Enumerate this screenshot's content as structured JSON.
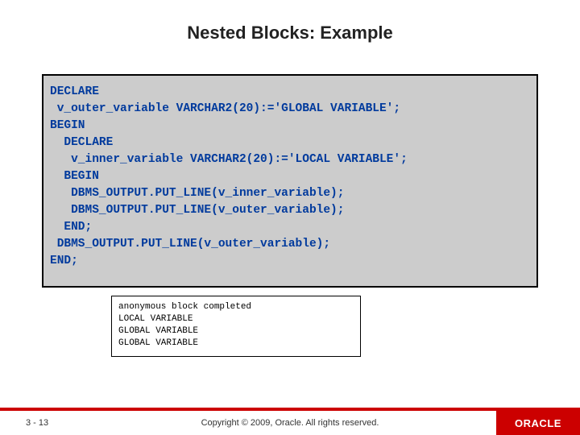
{
  "title": "Nested Blocks: Example",
  "code": {
    "l1": "DECLARE",
    "l2": " v_outer_variable VARCHAR2(20):='GLOBAL VARIABLE';",
    "l3": "BEGIN",
    "l4": "  DECLARE",
    "l5": "   v_inner_variable VARCHAR2(20):='LOCAL VARIABLE';",
    "l6": "  BEGIN",
    "l7": "   DBMS_OUTPUT.PUT_LINE(v_inner_variable);",
    "l8": "   DBMS_OUTPUT.PUT_LINE(v_outer_variable);",
    "l9": "  END;",
    "l10": " DBMS_OUTPUT.PUT_LINE(v_outer_variable);",
    "l11": "END;"
  },
  "output": {
    "l1": "anonymous block completed",
    "l2": "LOCAL VARIABLE",
    "l3": "GLOBAL VARIABLE",
    "l4": "GLOBAL VARIABLE"
  },
  "footer": {
    "page": "3 - 13",
    "copyright": "Copyright © 2009, Oracle. All rights reserved.",
    "brand": "ORACLE"
  }
}
